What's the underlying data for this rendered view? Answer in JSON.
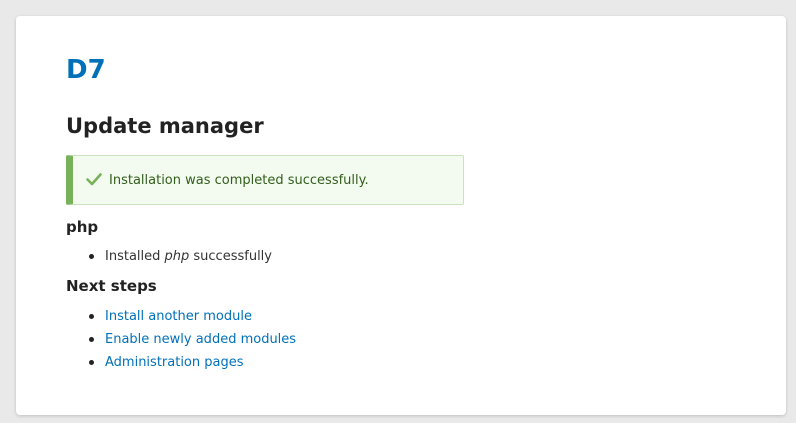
{
  "site": {
    "name": "D7"
  },
  "page": {
    "title": "Update manager"
  },
  "message": {
    "type": "status",
    "icon": "check-icon",
    "text": "Installation was completed successfully.",
    "accent_color": "#77b259"
  },
  "project": {
    "title": "php",
    "results": [
      {
        "prefix": "Installed ",
        "name": "php",
        "suffix": " successfully"
      }
    ]
  },
  "next_steps": {
    "title": "Next steps",
    "links": [
      {
        "label": "Install another module"
      },
      {
        "label": "Enable newly added modules"
      },
      {
        "label": "Administration pages"
      }
    ]
  },
  "colors": {
    "link": "#0071b8",
    "background": "#e9e9e9",
    "card": "#ffffff"
  }
}
